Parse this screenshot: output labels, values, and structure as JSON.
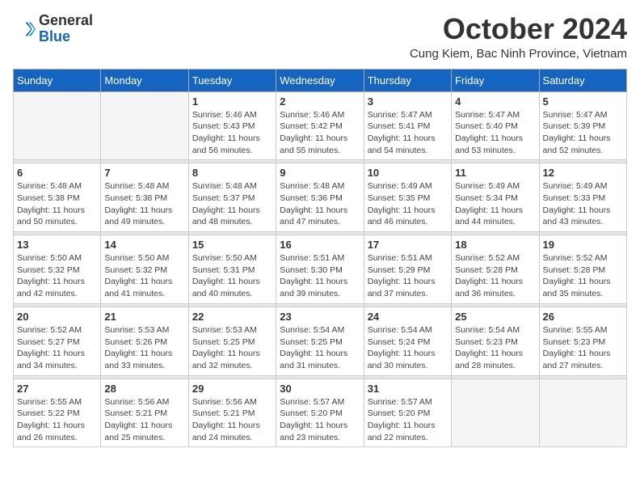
{
  "header": {
    "logo": {
      "general": "General",
      "blue": "Blue"
    },
    "title": "October 2024",
    "location": "Cung Kiem, Bac Ninh Province, Vietnam"
  },
  "calendar": {
    "days_of_week": [
      "Sunday",
      "Monday",
      "Tuesday",
      "Wednesday",
      "Thursday",
      "Friday",
      "Saturday"
    ],
    "weeks": [
      [
        {
          "day": "",
          "info": ""
        },
        {
          "day": "",
          "info": ""
        },
        {
          "day": "1",
          "info": "Sunrise: 5:46 AM\nSunset: 5:43 PM\nDaylight: 11 hours and 56 minutes."
        },
        {
          "day": "2",
          "info": "Sunrise: 5:46 AM\nSunset: 5:42 PM\nDaylight: 11 hours and 55 minutes."
        },
        {
          "day": "3",
          "info": "Sunrise: 5:47 AM\nSunset: 5:41 PM\nDaylight: 11 hours and 54 minutes."
        },
        {
          "day": "4",
          "info": "Sunrise: 5:47 AM\nSunset: 5:40 PM\nDaylight: 11 hours and 53 minutes."
        },
        {
          "day": "5",
          "info": "Sunrise: 5:47 AM\nSunset: 5:39 PM\nDaylight: 11 hours and 52 minutes."
        }
      ],
      [
        {
          "day": "6",
          "info": "Sunrise: 5:48 AM\nSunset: 5:38 PM\nDaylight: 11 hours and 50 minutes."
        },
        {
          "day": "7",
          "info": "Sunrise: 5:48 AM\nSunset: 5:38 PM\nDaylight: 11 hours and 49 minutes."
        },
        {
          "day": "8",
          "info": "Sunrise: 5:48 AM\nSunset: 5:37 PM\nDaylight: 11 hours and 48 minutes."
        },
        {
          "day": "9",
          "info": "Sunrise: 5:48 AM\nSunset: 5:36 PM\nDaylight: 11 hours and 47 minutes."
        },
        {
          "day": "10",
          "info": "Sunrise: 5:49 AM\nSunset: 5:35 PM\nDaylight: 11 hours and 46 minutes."
        },
        {
          "day": "11",
          "info": "Sunrise: 5:49 AM\nSunset: 5:34 PM\nDaylight: 11 hours and 44 minutes."
        },
        {
          "day": "12",
          "info": "Sunrise: 5:49 AM\nSunset: 5:33 PM\nDaylight: 11 hours and 43 minutes."
        }
      ],
      [
        {
          "day": "13",
          "info": "Sunrise: 5:50 AM\nSunset: 5:32 PM\nDaylight: 11 hours and 42 minutes."
        },
        {
          "day": "14",
          "info": "Sunrise: 5:50 AM\nSunset: 5:32 PM\nDaylight: 11 hours and 41 minutes."
        },
        {
          "day": "15",
          "info": "Sunrise: 5:50 AM\nSunset: 5:31 PM\nDaylight: 11 hours and 40 minutes."
        },
        {
          "day": "16",
          "info": "Sunrise: 5:51 AM\nSunset: 5:30 PM\nDaylight: 11 hours and 39 minutes."
        },
        {
          "day": "17",
          "info": "Sunrise: 5:51 AM\nSunset: 5:29 PM\nDaylight: 11 hours and 37 minutes."
        },
        {
          "day": "18",
          "info": "Sunrise: 5:52 AM\nSunset: 5:28 PM\nDaylight: 11 hours and 36 minutes."
        },
        {
          "day": "19",
          "info": "Sunrise: 5:52 AM\nSunset: 5:28 PM\nDaylight: 11 hours and 35 minutes."
        }
      ],
      [
        {
          "day": "20",
          "info": "Sunrise: 5:52 AM\nSunset: 5:27 PM\nDaylight: 11 hours and 34 minutes."
        },
        {
          "day": "21",
          "info": "Sunrise: 5:53 AM\nSunset: 5:26 PM\nDaylight: 11 hours and 33 minutes."
        },
        {
          "day": "22",
          "info": "Sunrise: 5:53 AM\nSunset: 5:25 PM\nDaylight: 11 hours and 32 minutes."
        },
        {
          "day": "23",
          "info": "Sunrise: 5:54 AM\nSunset: 5:25 PM\nDaylight: 11 hours and 31 minutes."
        },
        {
          "day": "24",
          "info": "Sunrise: 5:54 AM\nSunset: 5:24 PM\nDaylight: 11 hours and 30 minutes."
        },
        {
          "day": "25",
          "info": "Sunrise: 5:54 AM\nSunset: 5:23 PM\nDaylight: 11 hours and 28 minutes."
        },
        {
          "day": "26",
          "info": "Sunrise: 5:55 AM\nSunset: 5:23 PM\nDaylight: 11 hours and 27 minutes."
        }
      ],
      [
        {
          "day": "27",
          "info": "Sunrise: 5:55 AM\nSunset: 5:22 PM\nDaylight: 11 hours and 26 minutes."
        },
        {
          "day": "28",
          "info": "Sunrise: 5:56 AM\nSunset: 5:21 PM\nDaylight: 11 hours and 25 minutes."
        },
        {
          "day": "29",
          "info": "Sunrise: 5:56 AM\nSunset: 5:21 PM\nDaylight: 11 hours and 24 minutes."
        },
        {
          "day": "30",
          "info": "Sunrise: 5:57 AM\nSunset: 5:20 PM\nDaylight: 11 hours and 23 minutes."
        },
        {
          "day": "31",
          "info": "Sunrise: 5:57 AM\nSunset: 5:20 PM\nDaylight: 11 hours and 22 minutes."
        },
        {
          "day": "",
          "info": ""
        },
        {
          "day": "",
          "info": ""
        }
      ]
    ]
  }
}
